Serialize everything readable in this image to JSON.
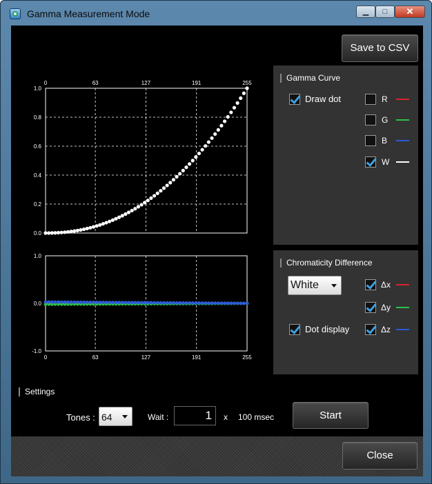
{
  "window": {
    "title": "Gamma Measurement Mode",
    "icon": "app-monitor-icon"
  },
  "titlebar_buttons": {
    "minimize": "▁",
    "maximize": "□",
    "close": "✕"
  },
  "toolbar": {
    "save_csv_label": "Save to CSV"
  },
  "gamma_panel": {
    "title": "Gamma Curve",
    "draw_dot": {
      "label": "Draw dot",
      "checked": true
    },
    "channels": [
      {
        "label": "R",
        "checked": false,
        "color": "#d8262b"
      },
      {
        "label": "G",
        "checked": false,
        "color": "#2fc04a"
      },
      {
        "label": "B",
        "checked": false,
        "color": "#2a5bd7"
      },
      {
        "label": "W",
        "checked": true,
        "color": "#ffffff"
      }
    ]
  },
  "chroma_panel": {
    "title": "Chromaticity Difference",
    "dropdown_value": "White",
    "dot_display": {
      "label": "Dot display",
      "checked": true
    },
    "deltas": [
      {
        "label": "Δx",
        "checked": true,
        "color": "#d8262b"
      },
      {
        "label": "Δy",
        "checked": true,
        "color": "#2fc04a"
      },
      {
        "label": "Δz",
        "checked": true,
        "color": "#2a5bd7"
      }
    ]
  },
  "settings": {
    "title": "Settings",
    "tones_label": "Tones :",
    "tones_value": "64",
    "wait_label": "Wait :",
    "wait_value": "1",
    "multiplier": "x",
    "unit": "100 msec",
    "start_label": "Start"
  },
  "footer": {
    "close_label": "Close"
  },
  "chart_data": [
    {
      "type": "scatter",
      "title": "",
      "x_ticks": [
        "0",
        "63",
        "127",
        "191",
        "255"
      ],
      "y_ticks": [
        "0.0",
        "0.2",
        "0.4",
        "0.6",
        "0.8",
        "1.0"
      ],
      "xlim": [
        0,
        255
      ],
      "ylim": [
        0,
        1
      ],
      "x_axis_position": "top",
      "grid": true,
      "series": [
        {
          "name": "W",
          "color": "#ffffff",
          "gamma": 2.2,
          "points": 64
        }
      ]
    },
    {
      "type": "scatter",
      "title": "",
      "x_ticks": [
        "0",
        "63",
        "127",
        "191",
        "255"
      ],
      "y_ticks": [
        "1.0",
        "0.0",
        "-1.0"
      ],
      "xlim": [
        0,
        255
      ],
      "ylim": [
        -1,
        1
      ],
      "x_axis_position": "bottom",
      "grid": true,
      "series": [
        {
          "name": "Δx",
          "color": "#d8262b",
          "start": 0.02,
          "end": 0.0
        },
        {
          "name": "Δy",
          "color": "#2fc04a",
          "start": -0.02,
          "end": 0.0
        },
        {
          "name": "Δz",
          "color": "#2a5bd7",
          "start": 0.03,
          "end": 0.0
        }
      ]
    }
  ]
}
